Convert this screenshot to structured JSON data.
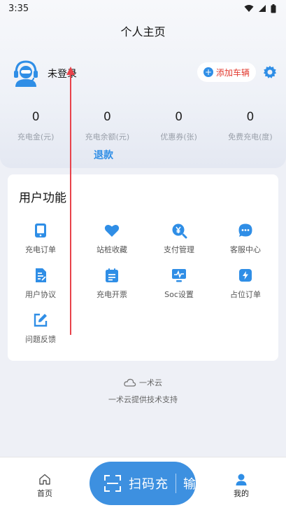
{
  "status_bar": {
    "time": "3:35"
  },
  "header": {
    "title": "个人主页",
    "login_text": "未登录",
    "add_car_label": "添加车辆"
  },
  "stats": [
    {
      "value": "0",
      "label": "充电金(元)"
    },
    {
      "value": "0",
      "label": "充电余额(元)"
    },
    {
      "value": "0",
      "label": "优惠券(张)"
    },
    {
      "value": "0",
      "label": "免费充电(度)"
    }
  ],
  "refund_label": "退款",
  "functions": {
    "title": "用户功能",
    "items": [
      {
        "label": "充电订单",
        "icon": "tablet-icon"
      },
      {
        "label": "站桩收藏",
        "icon": "heart-icon"
      },
      {
        "label": "支付管理",
        "icon": "yen-search-icon"
      },
      {
        "label": "客服中心",
        "icon": "chat-icon"
      },
      {
        "label": "用户协议",
        "icon": "document-icon"
      },
      {
        "label": "充电开票",
        "icon": "calendar-icon"
      },
      {
        "label": "Soc设置",
        "icon": "monitor-icon"
      },
      {
        "label": "占位订单",
        "icon": "lightning-icon"
      },
      {
        "label": "问题反馈",
        "icon": "edit-icon"
      }
    ]
  },
  "support": {
    "logo_text": "一术云",
    "text": "一术云提供技术支持"
  },
  "tabbar": {
    "home_label": "首页",
    "scan_label": "扫码充",
    "scan_extra": "输",
    "mine_label": "我的"
  },
  "colors": {
    "accent": "#2f8ee6",
    "scan_button": "#3d90e0",
    "add_car_text": "#e23a2f",
    "annotation": "#e8434b"
  }
}
